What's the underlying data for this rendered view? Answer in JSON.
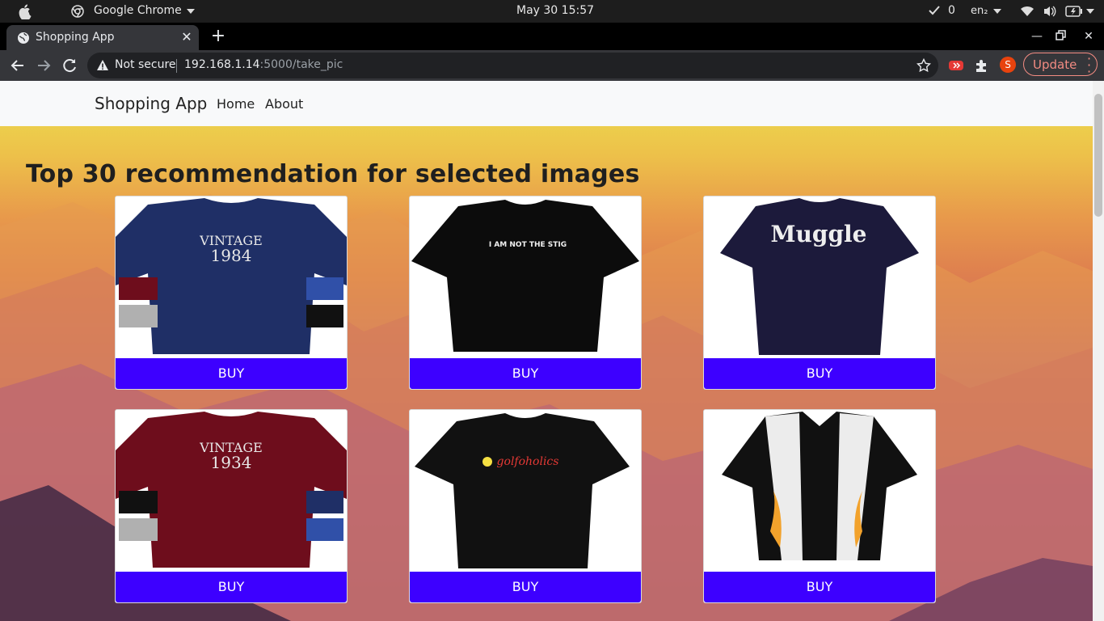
{
  "os": {
    "app_name": "Google Chrome",
    "clock": "May 30  15:57",
    "notif_count": "0",
    "lang": "en₂"
  },
  "browser": {
    "tab_title": "Shopping App",
    "tab_close": "✕",
    "new_tab": "+",
    "security_label": "Not secure",
    "url_host": "192.168.1.14",
    "url_path": ":5000/take_pic",
    "profile_initial": "S",
    "update_label": "Update"
  },
  "page": {
    "brand": "Shopping App",
    "nav": [
      "Home",
      "About"
    ],
    "heading": "Top 30 recommendation for selected images",
    "products": [
      {
        "shirt_color": "#1f2f66",
        "print": "VINTAGE 1984",
        "buy": "BUY"
      },
      {
        "shirt_color": "#0c0c0c",
        "print": "I AM NOT THE STIG",
        "buy": "BUY"
      },
      {
        "shirt_color": "#1c1a3b",
        "print": "Muggle",
        "buy": "BUY"
      },
      {
        "shirt_color": "#6e0d1c",
        "print": "VINTAGE 1934",
        "buy": "BUY"
      },
      {
        "shirt_color": "#111111",
        "print": "golfoholics",
        "buy": "BUY"
      },
      {
        "shirt_color": "#111111",
        "print": "",
        "buy": "BUY"
      }
    ]
  },
  "colors": {
    "buy_button": "#3d00ff",
    "navbar_bg": "#f8f9fa",
    "chrome_dark": "#35363a"
  }
}
